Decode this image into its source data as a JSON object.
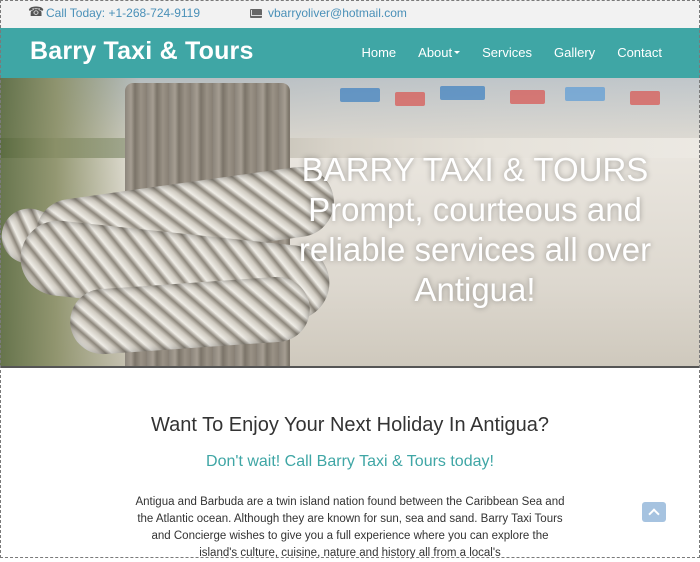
{
  "contact_bar": {
    "phone": "Call Today: +1-268-724-9119",
    "email": "vbarryoliver@hotmail.com"
  },
  "navbar": {
    "brand": "Barry Taxi & Tours",
    "items": [
      {
        "label": "Home"
      },
      {
        "label": "About"
      },
      {
        "label": "Services"
      },
      {
        "label": "Gallery"
      },
      {
        "label": "Contact"
      }
    ]
  },
  "hero": {
    "headline": "BARRY TAXI & TOURS Prompt, courteous and reliable services all over Antigua!"
  },
  "main": {
    "heading": "Want To Enjoy Your Next Holiday In Antigua?",
    "subheading": "Don't wait! Call Barry Taxi & Tours today!",
    "paragraph": "Antigua and Barbuda are a twin island nation found between the Caribbean Sea and the Atlantic ocean. Although they are known for sun, sea and sand. Barry Taxi Tours and Concierge wishes to give you a full experience where you can explore the island's culture, cuisine, nature and history all from a local's"
  },
  "icons": {
    "phone": "phone-icon",
    "email": "envelope-icon",
    "dropdown": "caret-down-icon",
    "scroll_top": "chevron-up-icon"
  },
  "colors": {
    "navbar": "#3fa6a5",
    "link": "#4a90b8",
    "accent_text": "#3fa6a5",
    "scroll_button": "#a6c3e0"
  }
}
